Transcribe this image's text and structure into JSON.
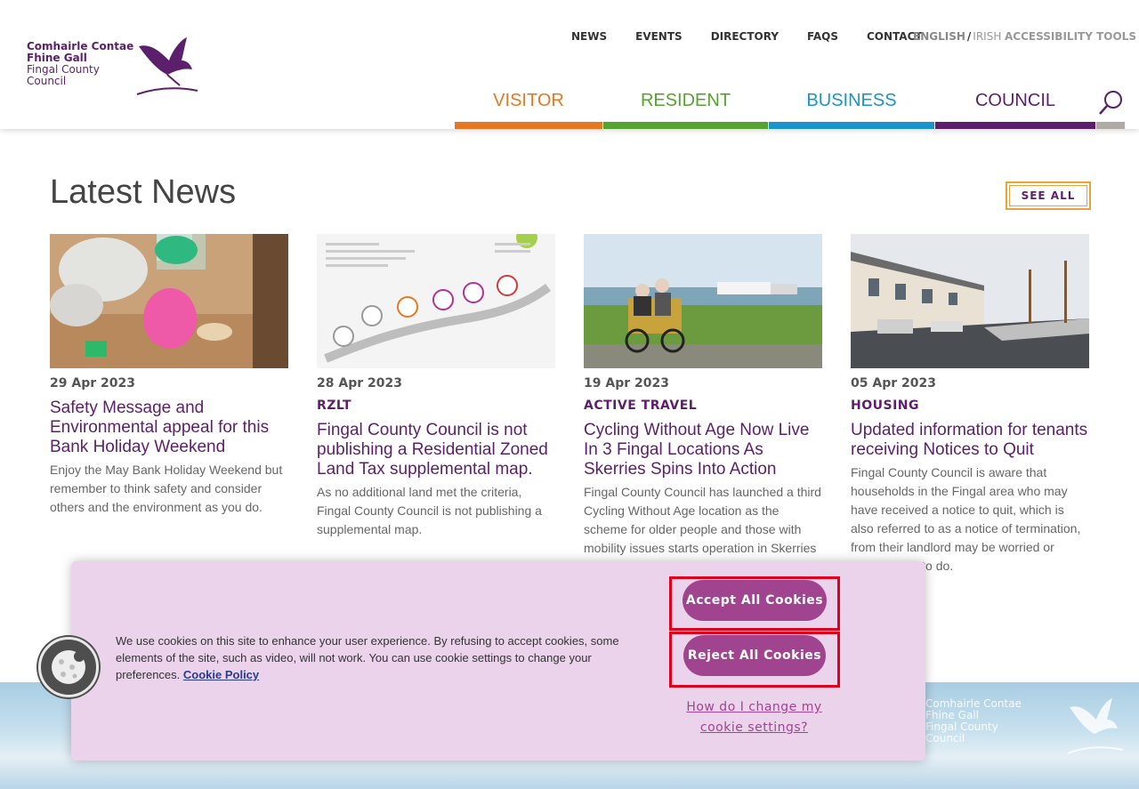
{
  "header": {
    "logo": {
      "line1": "Comhairle Contae",
      "line2": "Fhine Gall",
      "line3": "Fingal County",
      "line4": "Council"
    },
    "top_nav": [
      "NEWS",
      "EVENTS",
      "DIRECTORY",
      "FAQS",
      "CONTACT"
    ],
    "lang": {
      "english": "ENGLISH",
      "sep": "/",
      "irish": "IRISH"
    },
    "accessibility": "ACCESSIBILITY TOOLS",
    "main_nav": [
      {
        "label": "VISITOR",
        "color": "#e87722"
      },
      {
        "label": "RESIDENT",
        "color": "#57a331"
      },
      {
        "label": "BUSINESS",
        "color": "#1a94cf"
      },
      {
        "label": "COUNCIL",
        "color": "#5b1f6b"
      }
    ]
  },
  "news": {
    "title": "Latest News",
    "see_all": "SEE ALL",
    "cards": [
      {
        "date": "29 Apr 2023",
        "category": "",
        "title": "Safety Message and Environmental appeal for this Bank Holiday Weekend",
        "desc": "Enjoy the May Bank Holiday Weekend but remember to think safety and consider others and the environment as you do."
      },
      {
        "date": "28 Apr 2023",
        "category": "RZLT",
        "title": "Fingal County Council is not publishing a Residential Zoned Land Tax supplemental map.",
        "desc": "As no additional land met the criteria, Fingal County Council is not publishing a supplemental map."
      },
      {
        "date": "19 Apr 2023",
        "category": "ACTIVE TRAVEL",
        "title": "Cycling Without Age Now Live In 3 Fingal Locations As Skerries Spins Into Action",
        "desc": "Fingal County Council has launched a third Cycling Without Age location as the scheme for older people and those with mobility issues starts operation in Skerries this week."
      },
      {
        "date": "05 Apr 2023",
        "category": "HOUSING",
        "title": "Updated information for tenants receiving Notices to Quit",
        "desc": "Fingal County Council is aware that households in the Fingal area who may have received a notice to quit, which is also referred to as a notice of termination, from their landlord may be worried or unsure what to do."
      }
    ]
  },
  "cookie": {
    "text": "We use cookies on this site to enhance your user experience. By refusing to accept cookies, some elements of the site, such as video, will not work. You can use cookie settings to change your preferences.",
    "policy_link": "Cookie Policy",
    "accept": "Accept All Cookies",
    "reject": "Reject All Cookies",
    "change_link": "How do I change my cookie settings?"
  },
  "colors": {
    "brand_purple": "#5b1f6b",
    "cookie_bg": "#ecd3ec",
    "button": "#a0448f",
    "highlight": "#e0001b"
  }
}
